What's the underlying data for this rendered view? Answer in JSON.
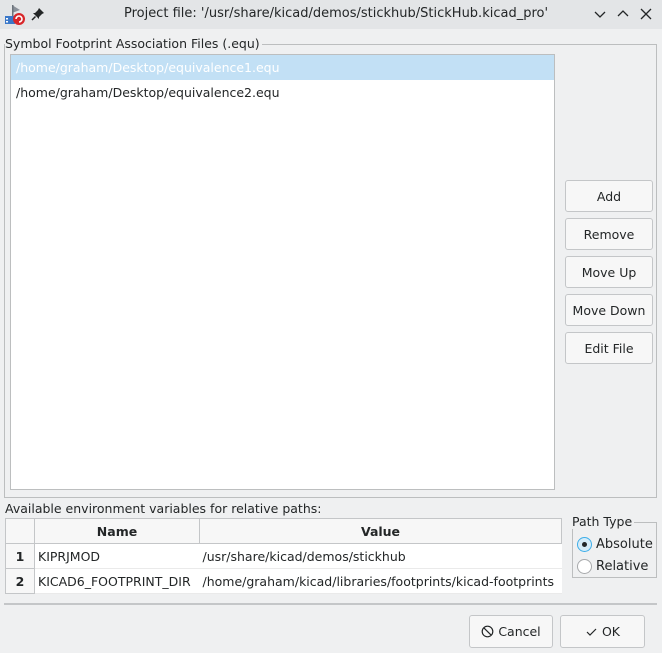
{
  "window": {
    "title": "Project file: '/usr/share/kicad/demos/stickhub/StickHub.kicad_pro'",
    "icons": [
      "kicad-app-icon",
      "pin-icon"
    ],
    "controls": [
      "minimize",
      "maximize",
      "close"
    ]
  },
  "equ_files": {
    "group_label": "Symbol Footprint Association Files (.equ)",
    "items": [
      {
        "path": "/home/graham/Desktop/equivalence1.equ",
        "selected": true
      },
      {
        "path": "/home/graham/Desktop/equivalence2.equ",
        "selected": false
      }
    ],
    "buttons": {
      "add": "Add",
      "remove": "Remove",
      "move_up": "Move Up",
      "move_down": "Move Down",
      "edit_file": "Edit File"
    }
  },
  "env_vars": {
    "label": "Available environment variables for relative paths:",
    "columns": [
      "Name",
      "Value"
    ],
    "rows": [
      {
        "index": "1",
        "name": "KIPRJMOD",
        "value": "/usr/share/kicad/demos/stickhub"
      },
      {
        "index": "2",
        "name": "KICAD6_FOOTPRINT_DIR",
        "value": "/home/graham/kicad/libraries/footprints/kicad-footprints"
      }
    ]
  },
  "path_type": {
    "label": "Path Type",
    "options": [
      {
        "label": "Absolute",
        "checked": true
      },
      {
        "label": "Relative",
        "checked": false
      }
    ]
  },
  "dialog_buttons": {
    "cancel": "Cancel",
    "ok": "OK"
  },
  "colors": {
    "selection": "#c2e0f5",
    "accent": "#3daee9",
    "background": "#eff0f1"
  }
}
